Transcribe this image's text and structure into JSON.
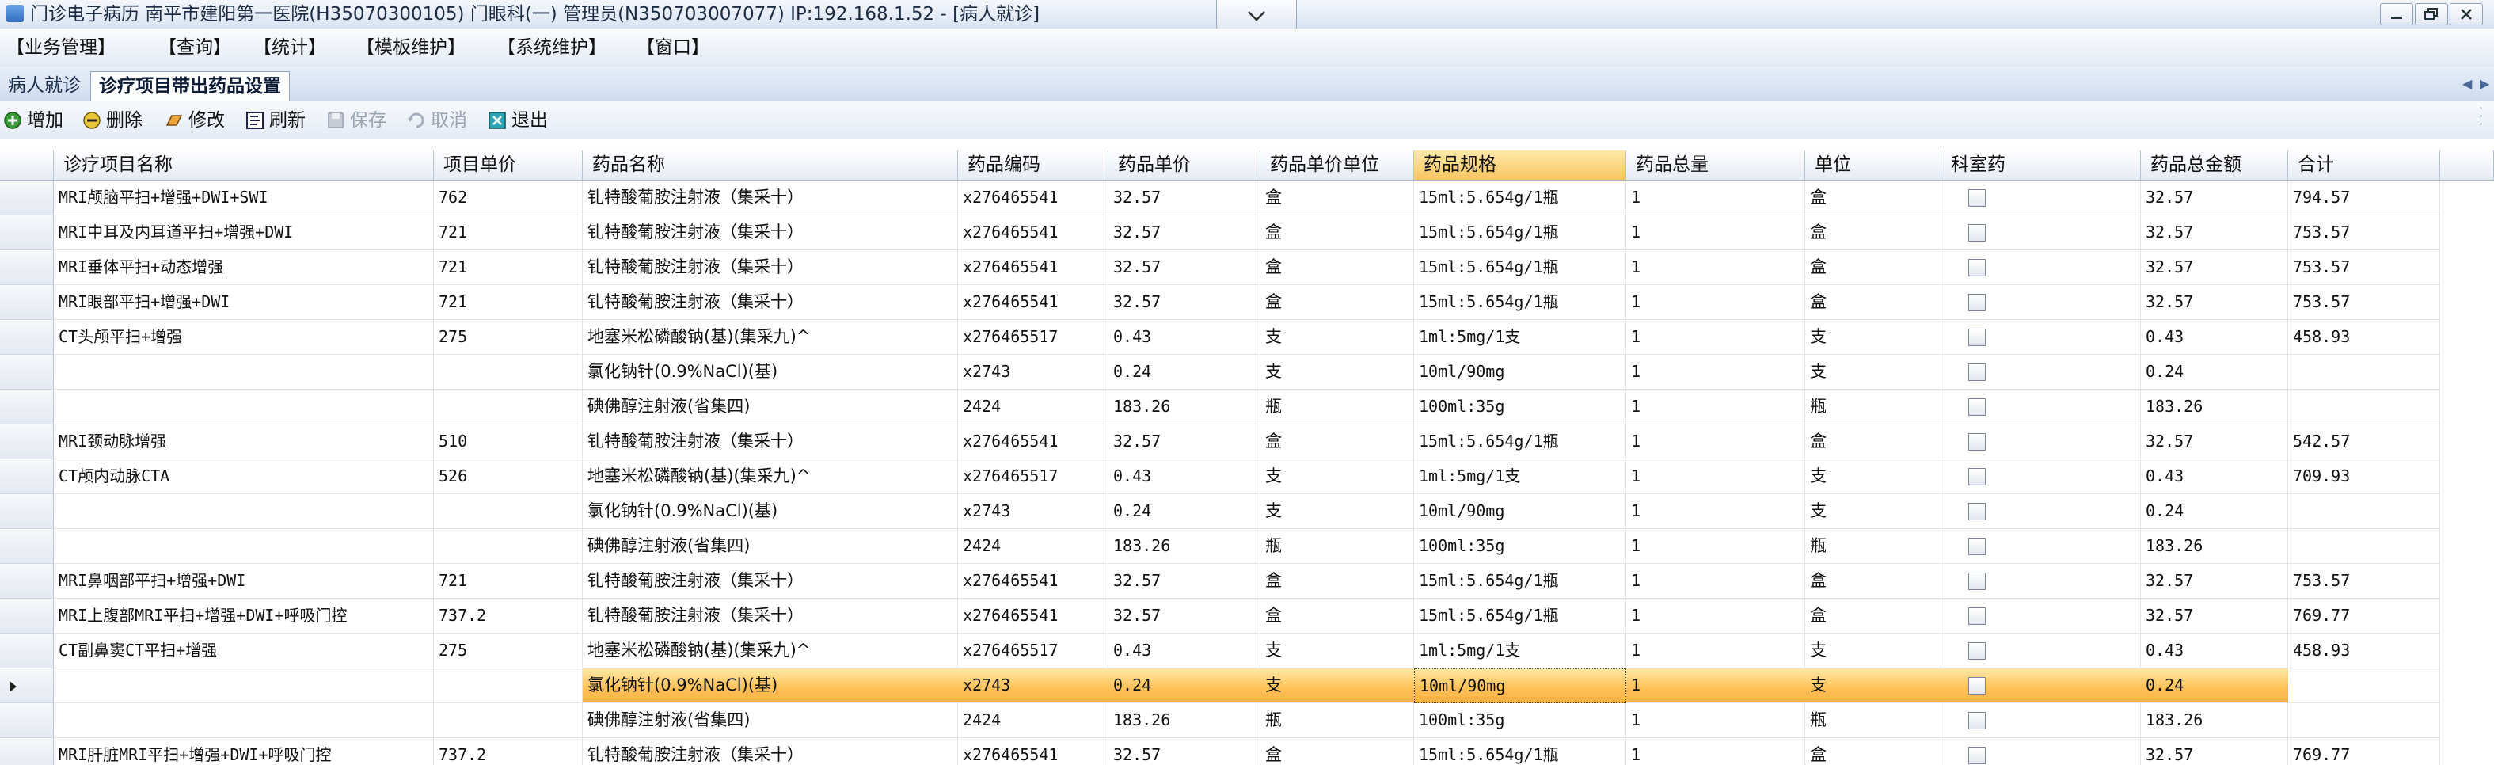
{
  "window": {
    "title": "门诊电子病历  南平市建阳第一医院(H35070300105)  门眼科(一)  管理员(N350703007077) IP:192.168.1.52 - [病人就诊]"
  },
  "menu": [
    "【业务管理】",
    "【查询】",
    "【统计】",
    "【模板维护】",
    "【系统维护】",
    "【窗口】"
  ],
  "tabs": [
    {
      "label": "病人就诊",
      "active": false
    },
    {
      "label": "诊疗项目带出药品设置",
      "active": true
    }
  ],
  "toolbar": [
    {
      "label": "增加",
      "icon": "add-icon",
      "enabled": true
    },
    {
      "label": "删除",
      "icon": "delete-icon",
      "enabled": true
    },
    {
      "label": "修改",
      "icon": "edit-icon",
      "enabled": true
    },
    {
      "label": "刷新",
      "icon": "refresh-icon",
      "enabled": true
    },
    {
      "label": "保存",
      "icon": "save-icon",
      "enabled": false
    },
    {
      "label": "取消",
      "icon": "cancel-icon",
      "enabled": false
    },
    {
      "label": "退出",
      "icon": "exit-icon",
      "enabled": true
    }
  ],
  "columns": [
    "诊疗项目名称",
    "项目单价",
    "药品名称",
    "药品编码",
    "药品单价",
    "药品单价单位",
    "药品规格",
    "药品总量",
    "单位",
    "科室药",
    "药品总金额",
    "合计"
  ],
  "sorted_column": "药品规格",
  "rows": [
    {
      "project": "MRI颅脑平扫+增强+DWI+SWI",
      "price": "762",
      "drug": "钆特酸葡胺注射液（集采十）",
      "code": "x276465541",
      "unit_price": "32.57",
      "price_unit": "盒",
      "spec": "15ml:5.654g/1瓶",
      "qty": "1",
      "unit": "盒",
      "dept": false,
      "amount": "32.57",
      "total": "794.57"
    },
    {
      "project": "MRI中耳及内耳道平扫+增强+DWI",
      "price": "721",
      "drug": "钆特酸葡胺注射液（集采十）",
      "code": "x276465541",
      "unit_price": "32.57",
      "price_unit": "盒",
      "spec": "15ml:5.654g/1瓶",
      "qty": "1",
      "unit": "盒",
      "dept": false,
      "amount": "32.57",
      "total": "753.57"
    },
    {
      "project": "MRI垂体平扫+动态增强",
      "price": "721",
      "drug": "钆特酸葡胺注射液（集采十）",
      "code": "x276465541",
      "unit_price": "32.57",
      "price_unit": "盒",
      "spec": "15ml:5.654g/1瓶",
      "qty": "1",
      "unit": "盒",
      "dept": false,
      "amount": "32.57",
      "total": "753.57"
    },
    {
      "project": "MRI眼部平扫+增强+DWI",
      "price": "721",
      "drug": "钆特酸葡胺注射液（集采十）",
      "code": "x276465541",
      "unit_price": "32.57",
      "price_unit": "盒",
      "spec": "15ml:5.654g/1瓶",
      "qty": "1",
      "unit": "盒",
      "dept": false,
      "amount": "32.57",
      "total": "753.57"
    },
    {
      "project": "CT头颅平扫+增强",
      "price": "275",
      "drug": "地塞米松磷酸钠(基)(集采九)^",
      "code": "x276465517",
      "unit_price": "0.43",
      "price_unit": "支",
      "spec": "1ml:5mg/1支",
      "qty": "1",
      "unit": "支",
      "dept": false,
      "amount": "0.43",
      "total": "458.93"
    },
    {
      "project": "",
      "price": "",
      "drug": "氯化钠针(0.9%NaCl)(基)",
      "code": "x2743",
      "unit_price": "0.24",
      "price_unit": "支",
      "spec": "10ml/90mg",
      "qty": "1",
      "unit": "支",
      "dept": false,
      "amount": "0.24",
      "total": ""
    },
    {
      "project": "",
      "price": "",
      "drug": "碘佛醇注射液(省集四)",
      "code": "2424",
      "unit_price": "183.26",
      "price_unit": "瓶",
      "spec": "100ml:35g",
      "qty": "1",
      "unit": "瓶",
      "dept": false,
      "amount": "183.26",
      "total": ""
    },
    {
      "project": "MRI颈动脉增强",
      "price": "510",
      "drug": "钆特酸葡胺注射液（集采十）",
      "code": "x276465541",
      "unit_price": "32.57",
      "price_unit": "盒",
      "spec": "15ml:5.654g/1瓶",
      "qty": "1",
      "unit": "盒",
      "dept": false,
      "amount": "32.57",
      "total": "542.57"
    },
    {
      "project": "CT颅内动脉CTA",
      "price": "526",
      "drug": "地塞米松磷酸钠(基)(集采九)^",
      "code": "x276465517",
      "unit_price": "0.43",
      "price_unit": "支",
      "spec": "1ml:5mg/1支",
      "qty": "1",
      "unit": "支",
      "dept": false,
      "amount": "0.43",
      "total": "709.93"
    },
    {
      "project": "",
      "price": "",
      "drug": "氯化钠针(0.9%NaCl)(基)",
      "code": "x2743",
      "unit_price": "0.24",
      "price_unit": "支",
      "spec": "10ml/90mg",
      "qty": "1",
      "unit": "支",
      "dept": false,
      "amount": "0.24",
      "total": ""
    },
    {
      "project": "",
      "price": "",
      "drug": "碘佛醇注射液(省集四)",
      "code": "2424",
      "unit_price": "183.26",
      "price_unit": "瓶",
      "spec": "100ml:35g",
      "qty": "1",
      "unit": "瓶",
      "dept": false,
      "amount": "183.26",
      "total": ""
    },
    {
      "project": "MRI鼻咽部平扫+增强+DWI",
      "price": "721",
      "drug": "钆特酸葡胺注射液（集采十）",
      "code": "x276465541",
      "unit_price": "32.57",
      "price_unit": "盒",
      "spec": "15ml:5.654g/1瓶",
      "qty": "1",
      "unit": "盒",
      "dept": false,
      "amount": "32.57",
      "total": "753.57"
    },
    {
      "project": "MRI上腹部MRI平扫+增强+DWI+呼吸门控",
      "price": "737.2",
      "drug": "钆特酸葡胺注射液（集采十）",
      "code": "x276465541",
      "unit_price": "32.57",
      "price_unit": "盒",
      "spec": "15ml:5.654g/1瓶",
      "qty": "1",
      "unit": "盒",
      "dept": false,
      "amount": "32.57",
      "total": "769.77"
    },
    {
      "project": "CT副鼻窦CT平扫+增强",
      "price": "275",
      "drug": "地塞米松磷酸钠(基)(集采九)^",
      "code": "x276465517",
      "unit_price": "0.43",
      "price_unit": "支",
      "spec": "1ml:5mg/1支",
      "qty": "1",
      "unit": "支",
      "dept": false,
      "amount": "0.43",
      "total": "458.93"
    },
    {
      "project": "",
      "price": "",
      "drug": "氯化钠针(0.9%NaCl)(基)",
      "code": "x2743",
      "unit_price": "0.24",
      "price_unit": "支",
      "spec": "10ml/90mg",
      "qty": "1",
      "unit": "支",
      "dept": false,
      "amount": "0.24",
      "total": ""
    },
    {
      "project": "",
      "price": "",
      "drug": "碘佛醇注射液(省集四)",
      "code": "2424",
      "unit_price": "183.26",
      "price_unit": "瓶",
      "spec": "100ml:35g",
      "qty": "1",
      "unit": "瓶",
      "dept": false,
      "amount": "183.26",
      "total": ""
    },
    {
      "project": "MRI肝脏MRI平扫+增强+DWI+呼吸门控",
      "price": "737.2",
      "drug": "钆特酸葡胺注射液（集采十）",
      "code": "x276465541",
      "unit_price": "32.57",
      "price_unit": "盒",
      "spec": "15ml:5.654g/1瓶",
      "qty": "1",
      "unit": "盒",
      "dept": false,
      "amount": "32.57",
      "total": "769.77"
    }
  ],
  "selected_row": 14,
  "colors": {
    "selection": "#ffc25a",
    "sorted_header": "#f6c560",
    "chrome": "#dbe5f3"
  }
}
